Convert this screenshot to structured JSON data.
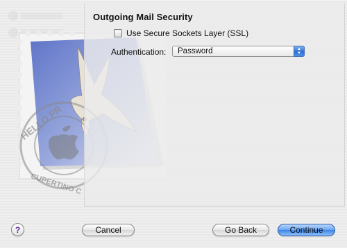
{
  "panel": {
    "title": "Outgoing Mail Security",
    "ssl_checkbox_label": "Use Secure Sockets Layer (SSL)",
    "ssl_checked": false,
    "authentication_label": "Authentication:",
    "authentication_value": "Password"
  },
  "stamp": {
    "postmark_top_text": "HELLO FR",
    "postmark_bottom_text": "CUPERTINO C"
  },
  "buttons": {
    "help_label": "?",
    "cancel_label": "Cancel",
    "back_label": "Go Back",
    "continue_label": "Continue"
  },
  "colors": {
    "accent": "#3b83e8",
    "stamp_sky": "#8f9fd6",
    "window": "#ececec"
  }
}
